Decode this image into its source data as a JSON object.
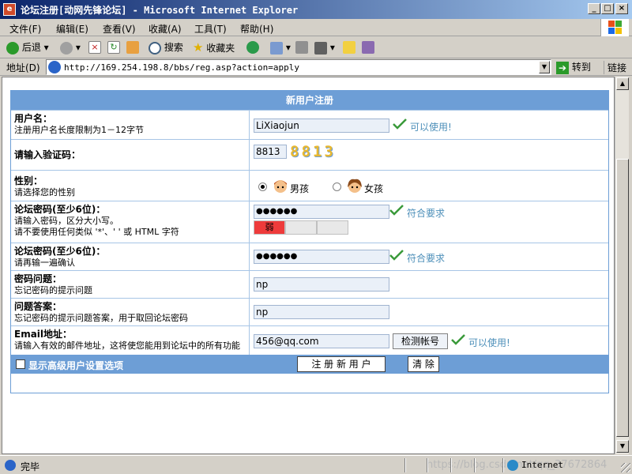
{
  "window": {
    "title": "论坛注册[动网先锋论坛] - Microsoft Internet Explorer",
    "icon": "ie-page-icon"
  },
  "menu": [
    "文件(F)",
    "编辑(E)",
    "查看(V)",
    "收藏(A)",
    "工具(T)",
    "帮助(H)"
  ],
  "toolbar": {
    "back": "后退",
    "search": "搜索",
    "favorites": "收藏夹"
  },
  "address": {
    "label": "地址(D)",
    "url": "http://169.254.198.8/bbs/reg.asp?action=apply",
    "go": "转到",
    "links": "链接"
  },
  "form": {
    "title": "新用户注册",
    "username": {
      "label": "用户名：",
      "desc": "注册用户名长度限制为1－12字节",
      "value": "LiXiaojun",
      "status": "可以使用!"
    },
    "captcha": {
      "label": "请输入验证码：",
      "value": "8813",
      "image_text": "8813"
    },
    "gender": {
      "label": "性别：",
      "desc": "请选择您的性别",
      "male": "男孩",
      "female": "女孩",
      "selected": "男孩"
    },
    "password": {
      "label": "论坛密码(至少6位)：",
      "desc1": "请输入密码，区分大小写。",
      "desc2": "请不要使用任何类似 '*'、' ' 或 HTML 字符",
      "value": "●●●●●●",
      "status": "符合要求",
      "strength": "弱"
    },
    "password_confirm": {
      "label": "论坛密码(至少6位)：",
      "desc": "请再输一遍确认",
      "value": "●●●●●●",
      "status": "符合要求"
    },
    "question": {
      "label": "密码问题：",
      "desc": "忘记密码的提示问题",
      "value": "np"
    },
    "answer": {
      "label": "问题答案：",
      "desc": "忘记密码的提示问题答案，用于取回论坛密码",
      "value": "np"
    },
    "email": {
      "label": "Email地址：",
      "desc": "请输入有效的邮件地址，这将使您能用到论坛中的所有功能",
      "value": "456@qq.com",
      "check_button": "检测帐号",
      "status": "可以使用!"
    },
    "advanced_label": "显示高级用户设置选项",
    "submit": "注 册 新 用 户",
    "reset": "清 除"
  },
  "status": {
    "text": "完毕",
    "zone": "Internet",
    "watermark": "https://blog.csdn.net/qq_37672864"
  },
  "colors": {
    "header_blue": "#6d9ed6",
    "status_text": "#4d8fb9",
    "strength_weak": "#ee3b3b"
  }
}
